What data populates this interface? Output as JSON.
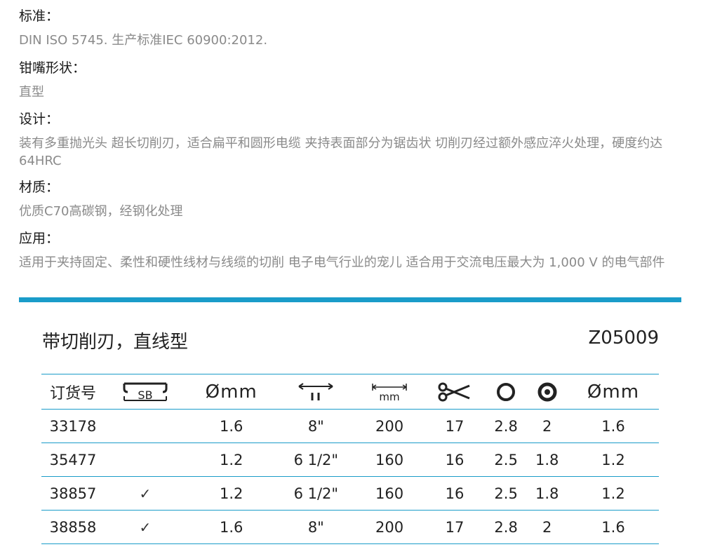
{
  "specs": [
    {
      "label": "标准：",
      "text": "DIN ISO 5745. 生产标准IEC 60900:2012."
    },
    {
      "label": "钳嘴形状：",
      "text": "直型"
    },
    {
      "label": "设计：",
      "text": "装有多重抛光头 超长切削刃，适合扁平和圆形电缆 夹持表面部分为锯齿状 切削刃经过额外感应淬火处理，硬度约达64HRC"
    },
    {
      "label": "材质：",
      "text": "优质C70高碳钢，经钢化处理"
    },
    {
      "label": "应用：",
      "text": "适用于夹持固定、柔性和硬性线材与线缆的切削 电子电气行业的宠儿 适合用于交流电压最大为 1,000 V 的电气部件"
    }
  ],
  "product": {
    "title": "带切削刃，直线型",
    "code": "Z05009"
  },
  "table": {
    "header": {
      "order_no": "订货号",
      "sb_label": "SB",
      "dia_symbol": "Ø",
      "mm": "mm",
      "length_unit": "mm",
      "icons": [
        "sb-box-icon",
        "diameter-icon",
        "length-inch-icon",
        "length-mm-icon",
        "scissors-icon",
        "ring-icon",
        "ring-dot-icon",
        "diameter-icon"
      ]
    },
    "rows": [
      {
        "order": "33178",
        "sb": "",
        "d1": "1.6",
        "inch": "8\"",
        "mm": "200",
        "cut": "17",
        "ring": "2.8",
        "ring2": "2",
        "d2": "1.6"
      },
      {
        "order": "35477",
        "sb": "",
        "d1": "1.2",
        "inch": "6 1/2\"",
        "mm": "160",
        "cut": "16",
        "ring": "2.5",
        "ring2": "1.8",
        "d2": "1.2"
      },
      {
        "order": "38857",
        "sb": "✓",
        "d1": "1.2",
        "inch": "6 1/2\"",
        "mm": "160",
        "cut": "16",
        "ring": "2.5",
        "ring2": "1.8",
        "d2": "1.2"
      },
      {
        "order": "38858",
        "sb": "✓",
        "d1": "1.6",
        "inch": "8\"",
        "mm": "200",
        "cut": "17",
        "ring": "2.8",
        "ring2": "2",
        "d2": "1.6"
      }
    ]
  },
  "colors": {
    "accent": "#1a9cc9",
    "muted_text": "#8a8a8a"
  }
}
